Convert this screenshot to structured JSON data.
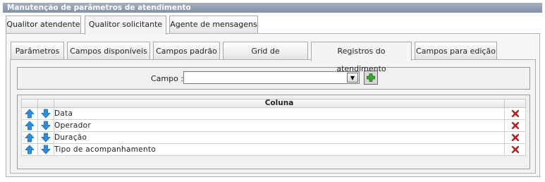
{
  "window": {
    "title": "Manutenção de parâmetros de atendimento"
  },
  "outer_tabs": [
    {
      "label": "Qualitor atendente",
      "active": false
    },
    {
      "label": "Qualitor solicitante",
      "active": true
    },
    {
      "label": "Agente de mensagens",
      "active": false
    }
  ],
  "inner_tabs": [
    {
      "label": "Parâmetros",
      "active": false
    },
    {
      "label": "Campos disponíveis",
      "active": false
    },
    {
      "label": "Campos padrão",
      "active": false
    },
    {
      "label": "Grid de atendimentos",
      "active": false
    },
    {
      "label": "Registros do atendimento",
      "active": true
    },
    {
      "label": "Campos para edição",
      "active": false
    }
  ],
  "field": {
    "label": "Campo :",
    "value": ""
  },
  "table": {
    "header": "Coluna",
    "rows": [
      {
        "column": "Data"
      },
      {
        "column": "Operador"
      },
      {
        "column": "Duração"
      },
      {
        "column": "Tipo de acompanhamento"
      }
    ]
  },
  "colors": {
    "titlebar": "#8e9aae",
    "arrow": "#2a8fe0",
    "add": "#38a82a",
    "delete": "#d42020"
  },
  "icons": {
    "up": "arrow-up-icon",
    "down": "arrow-down-icon",
    "add": "plus-icon",
    "delete": "delete-x-icon"
  }
}
